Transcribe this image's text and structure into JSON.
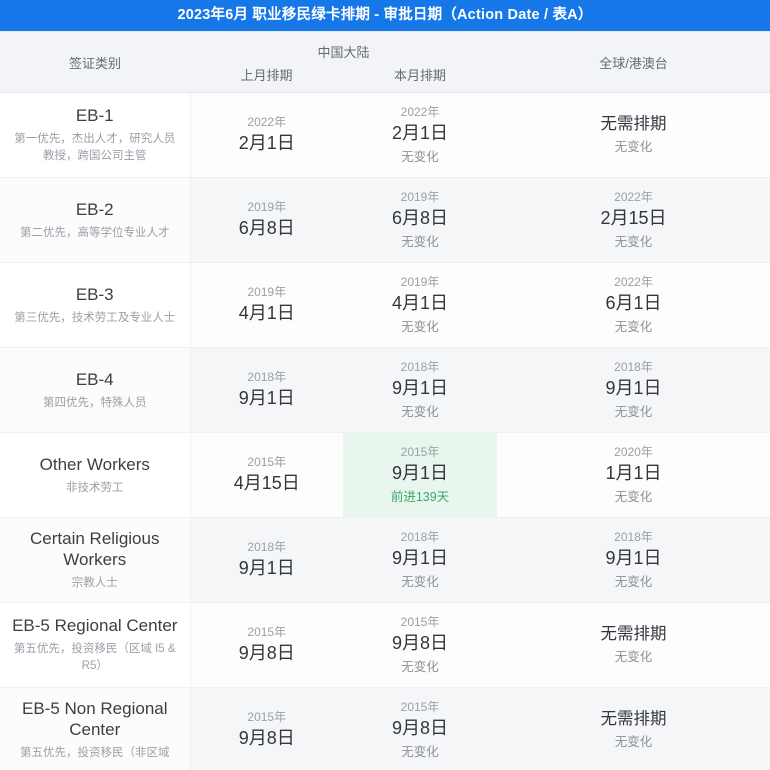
{
  "title": "2023年6月 职业移民绿卡排期 - 审批日期（Action Date / 表A）",
  "header": {
    "category": "签证类别",
    "china_group": "中国大陆",
    "prev_month": "上月排期",
    "this_month": "本月排期",
    "worldwide": "全球/港澳台"
  },
  "colors": {
    "banner": "#1677e8",
    "highlight_bg": "#e9f6ee",
    "advance_text": "#3aa869",
    "header_bg": "#f2f4f7",
    "alt_row_bg": "#f5f6f7"
  },
  "rows": [
    {
      "category": "EB-1",
      "desc": "第一优先，杰出人才，研究人员教授，跨国公司主管",
      "prev": {
        "year": "2022年",
        "date": "2月1日",
        "change": ""
      },
      "curr": {
        "year": "2022年",
        "date": "2月1日",
        "change": "无变化",
        "highlight": false
      },
      "world": {
        "year": "",
        "date": "无需排期",
        "change": "无变化"
      }
    },
    {
      "category": "EB-2",
      "desc": "第二优先，高等学位专业人才",
      "prev": {
        "year": "2019年",
        "date": "6月8日",
        "change": ""
      },
      "curr": {
        "year": "2019年",
        "date": "6月8日",
        "change": "无变化",
        "highlight": false
      },
      "world": {
        "year": "2022年",
        "date": "2月15日",
        "change": "无变化"
      }
    },
    {
      "category": "EB-3",
      "desc": "第三优先，技术劳工及专业人士",
      "prev": {
        "year": "2019年",
        "date": "4月1日",
        "change": ""
      },
      "curr": {
        "year": "2019年",
        "date": "4月1日",
        "change": "无变化",
        "highlight": false
      },
      "world": {
        "year": "2022年",
        "date": "6月1日",
        "change": "无变化"
      }
    },
    {
      "category": "EB-4",
      "desc": "第四优先，特殊人员",
      "prev": {
        "year": "2018年",
        "date": "9月1日",
        "change": ""
      },
      "curr": {
        "year": "2018年",
        "date": "9月1日",
        "change": "无变化",
        "highlight": false
      },
      "world": {
        "year": "2018年",
        "date": "9月1日",
        "change": "无变化"
      }
    },
    {
      "category": "Other Workers",
      "desc": "非技术劳工",
      "prev": {
        "year": "2015年",
        "date": "4月15日",
        "change": ""
      },
      "curr": {
        "year": "2015年",
        "date": "9月1日",
        "change": "前进139天",
        "highlight": true,
        "advance": true
      },
      "world": {
        "year": "2020年",
        "date": "1月1日",
        "change": "无变化"
      }
    },
    {
      "category": "Certain Religious Workers",
      "desc": "宗教人士",
      "prev": {
        "year": "2018年",
        "date": "9月1日",
        "change": ""
      },
      "curr": {
        "year": "2018年",
        "date": "9月1日",
        "change": "无变化",
        "highlight": false
      },
      "world": {
        "year": "2018年",
        "date": "9月1日",
        "change": "无变化"
      }
    },
    {
      "category": "EB-5 Regional Center",
      "desc": "第五优先，投资移民（区域 I5 & R5）",
      "prev": {
        "year": "2015年",
        "date": "9月8日",
        "change": ""
      },
      "curr": {
        "year": "2015年",
        "date": "9月8日",
        "change": "无变化",
        "highlight": false
      },
      "world": {
        "year": "",
        "date": "无需排期",
        "change": "无变化"
      }
    },
    {
      "category": "EB-5 Non Regional Center",
      "desc": "第五优先，投资移民（非区域",
      "prev": {
        "year": "2015年",
        "date": "9月8日",
        "change": ""
      },
      "curr": {
        "year": "2015年",
        "date": "9月8日",
        "change": "无变化",
        "highlight": false
      },
      "world": {
        "year": "",
        "date": "无需排期",
        "change": "无变化"
      }
    }
  ]
}
